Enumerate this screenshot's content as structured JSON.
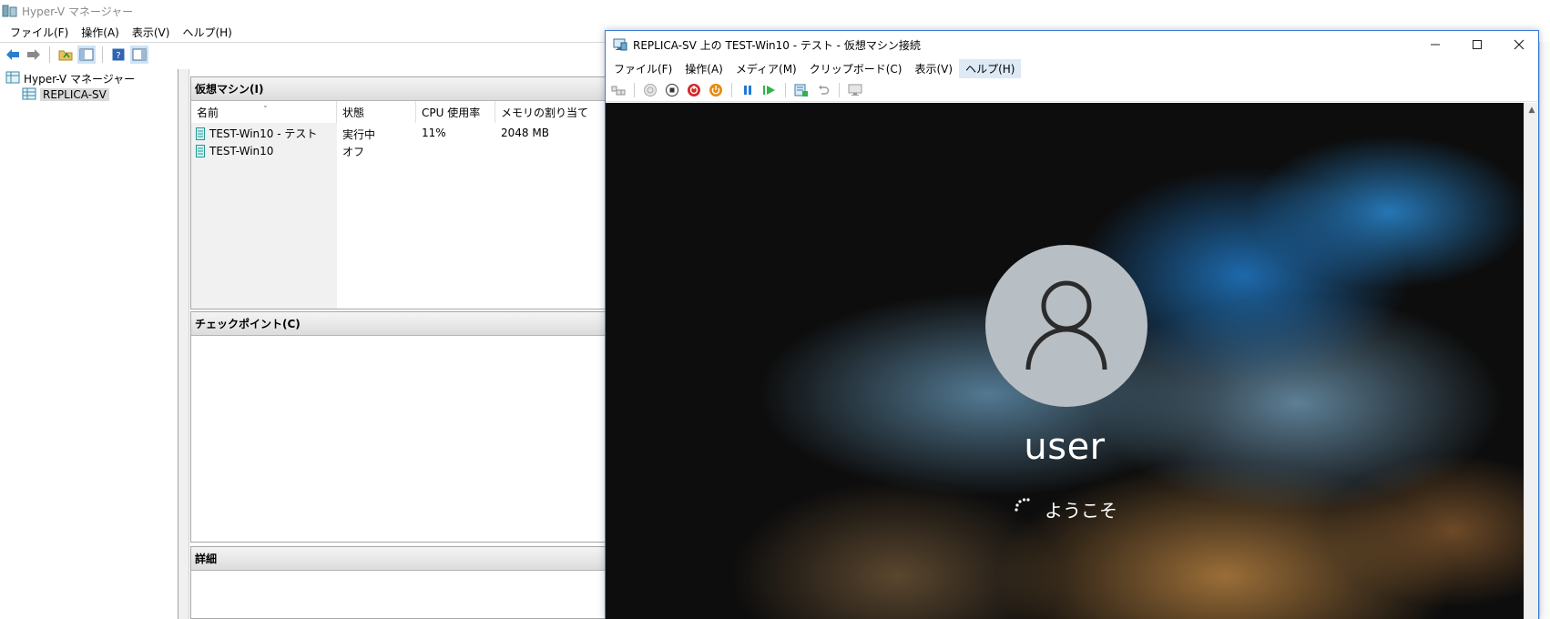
{
  "manager": {
    "title": "Hyper-V マネージャー",
    "menu": [
      "ファイル(F)",
      "操作(A)",
      "表示(V)",
      "ヘルプ(H)"
    ],
    "toolbar_icons": [
      "back-arrow-icon",
      "forward-arrow-icon",
      "up-folder-icon",
      "show-hide-console-tree-icon",
      "help-icon",
      "show-hide-action-pane-icon"
    ],
    "tree": {
      "root": "Hyper-V マネージャー",
      "server": "REPLICA-SV"
    },
    "vm_pane": {
      "header": "仮想マシン(I)",
      "columns": [
        "名前",
        "状態",
        "CPU 使用率",
        "メモリの割り当て"
      ],
      "rows": [
        {
          "name": "TEST-Win10 - テスト",
          "state": "実行中",
          "cpu": "11%",
          "memory": "2048 MB"
        },
        {
          "name": "TEST-Win10",
          "state": "オフ",
          "cpu": "",
          "memory": ""
        }
      ]
    },
    "checkpoint_pane": {
      "header": "チェックポイント(C)"
    },
    "detail_pane": {
      "header": "詳細"
    }
  },
  "vm_connection": {
    "title": "REPLICA-SV 上の TEST-Win10 - テスト - 仮想マシン接続",
    "menu": [
      "ファイル(F)",
      "操作(A)",
      "メディア(M)",
      "クリップボード(C)",
      "表示(V)",
      "ヘルプ(H)"
    ],
    "active_menu_index": 5,
    "window_controls": [
      "minimize-icon",
      "maximize-icon",
      "close-icon"
    ],
    "toolbar_icons": [
      "ctrl-alt-del-icon",
      "start-icon",
      "turn-off-icon",
      "shutdown-icon",
      "save-icon",
      "pause-icon",
      "reset-icon",
      "checkpoint-icon",
      "revert-icon",
      "enhanced-session-icon"
    ],
    "screen": {
      "user_name": "user",
      "welcome_text": "ようこそ"
    }
  },
  "colors": {
    "window_border": "#3a7bd5",
    "avatar_bg": "#b7bec4",
    "stop_red": "#d42a2a",
    "power_orange": "#e88a12",
    "pause_blue": "#1f7ad6",
    "reset_green": "#2fb34a"
  }
}
